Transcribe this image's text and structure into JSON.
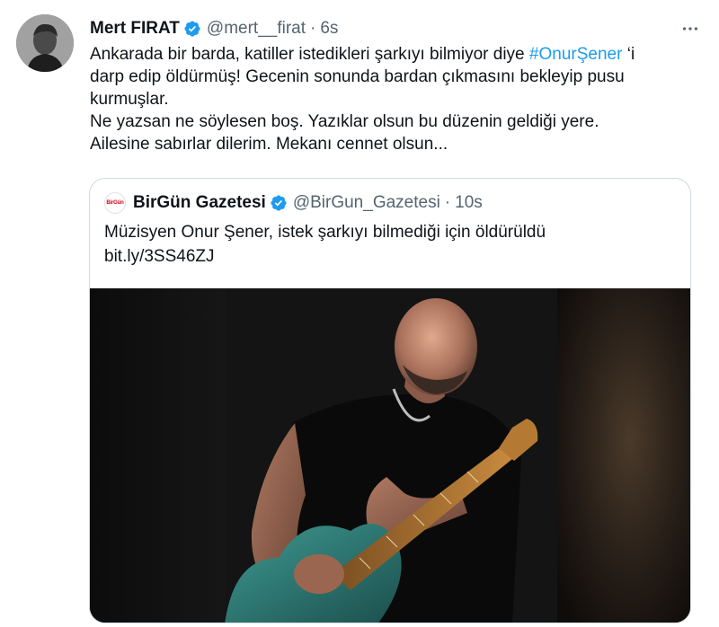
{
  "tweet": {
    "author_name": "Mert FIRAT",
    "handle": "@mert__firat",
    "separator": "·",
    "time": "6s",
    "body": {
      "line1_pre": "Ankarada bir barda, katiller istedikleri şarkıyı bilmiyor diye ",
      "hashtag": "#OnurŞener",
      "line1_post": " ‘i",
      "line2": "darp edip öldürmüş! Gecenin sonunda bardan çıkmasını bekleyip pusu",
      "line3": "kurmuşlar.",
      "line4": "Ne yazsan ne söylesen boş. Yazıklar olsun bu düzenin geldiği yere.",
      "line5": "Ailesine sabırlar dilerim. Mekanı cennet olsun..."
    }
  },
  "quote": {
    "avatar_text": "BirGün",
    "author_name": "BirGün Gazetesi",
    "handle": "@BirGun_Gazetesi",
    "separator": "·",
    "time": "10s",
    "text_line1": "Müzisyen Onur Şener, istek şarkıyı bilmediği için öldürüldü",
    "link": "bit.ly/3SS46ZJ"
  },
  "icons": {
    "verified": "verified-badge-icon",
    "more": "more-options-icon"
  },
  "colors": {
    "link": "#1d9bf0",
    "secondary_text": "#536471",
    "primary_text": "#0f1419",
    "border": "#cfd9de",
    "verified": "#1d9bf0"
  }
}
